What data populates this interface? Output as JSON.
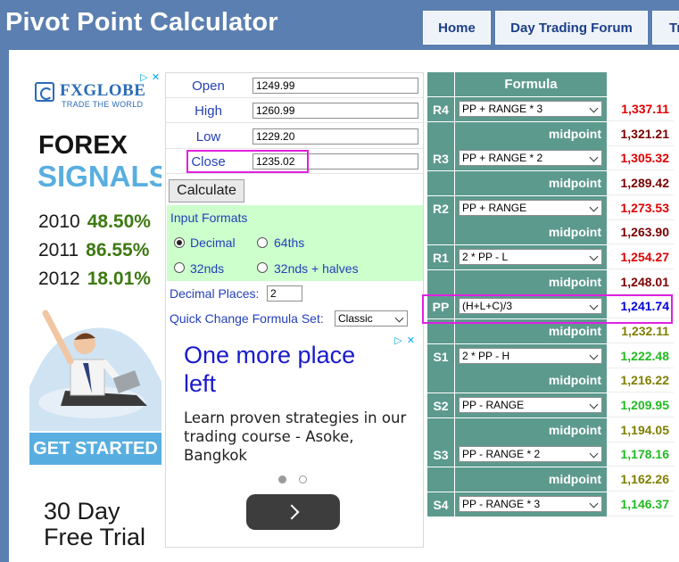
{
  "header": {
    "title": "Pivot Point Calculator",
    "nav": [
      {
        "label": "Home"
      },
      {
        "label": "Day Trading Forum"
      },
      {
        "label": "Tr"
      }
    ]
  },
  "left_ad": {
    "brand": "FXGLOBE",
    "tagline": "TRADE THE WORLD",
    "headline1": "FOREX",
    "headline2": "SIGNALS",
    "stats": [
      {
        "year": "2010",
        "value": "48.50%"
      },
      {
        "year": "2011",
        "value": "86.55%"
      },
      {
        "year": "2012",
        "value": "18.01%"
      }
    ],
    "cta": "GET STARTED",
    "trial_line1": "30 Day",
    "trial_line2": "Free Trial",
    "ad_choices": "▷",
    "close": "✕"
  },
  "inputs": {
    "open": {
      "label": "Open",
      "value": "1249.99"
    },
    "high": {
      "label": "High",
      "value": "1260.99"
    },
    "low": {
      "label": "Low",
      "value": "1229.20"
    },
    "close": {
      "label": "Close",
      "value": "1235.02"
    },
    "calculate": "Calculate",
    "formats_title": "Input Formats",
    "formats": {
      "decimal": "Decimal",
      "f64ths": "64ths",
      "f32nds": "32nds",
      "f32nds_halves": "32nds + halves",
      "selected": "Decimal"
    },
    "decimal_places_label": "Decimal Places:",
    "decimal_places_value": "2",
    "formula_set_label": "Quick Change Formula Set:",
    "formula_set_value": "Classic"
  },
  "panel_ad": {
    "headline": "One more place left",
    "body": "Learn proven strategies in our trading course - Asoke, Bangkok",
    "ad_choices": "▷",
    "close": "✕"
  },
  "pivot_table": {
    "header": "Formula",
    "midpoint_label": "midpoint",
    "levels": [
      {
        "label": "R4",
        "formula": "PP + RANGE * 3",
        "value": "1,337.11"
      },
      {
        "midpoint": "1,321.21"
      },
      {
        "label": "R3",
        "formula": "PP + RANGE * 2",
        "value": "1,305.32"
      },
      {
        "midpoint": "1,289.42"
      },
      {
        "label": "R2",
        "formula": "PP + RANGE",
        "value": "1,273.53"
      },
      {
        "midpoint": "1,263.90"
      },
      {
        "label": "R1",
        "formula": "2 * PP - L",
        "value": "1,254.27"
      },
      {
        "midpoint": "1,248.01"
      },
      {
        "label": "PP",
        "formula": "(H+L+C)/3",
        "value": "1,241.74"
      },
      {
        "midpoint": "1,232.11"
      },
      {
        "label": "S1",
        "formula": "2 * PP - H",
        "value": "1,222.48"
      },
      {
        "midpoint": "1,216.22"
      },
      {
        "label": "S2",
        "formula": "PP - RANGE",
        "value": "1,209.95"
      },
      {
        "midpoint": "1,194.05"
      },
      {
        "label": "S3",
        "formula": "PP - RANGE * 2",
        "value": "1,178.16"
      },
      {
        "midpoint": "1,162.26"
      },
      {
        "label": "S4",
        "formula": "PP - RANGE * 3",
        "value": "1,146.37"
      }
    ],
    "colors": {
      "resistance": "#e00000",
      "resistance_midpoint": "#7a0000",
      "pivot": "#0000e0",
      "support_midpoint": "#7f7f00",
      "support": "#22bb22"
    }
  }
}
